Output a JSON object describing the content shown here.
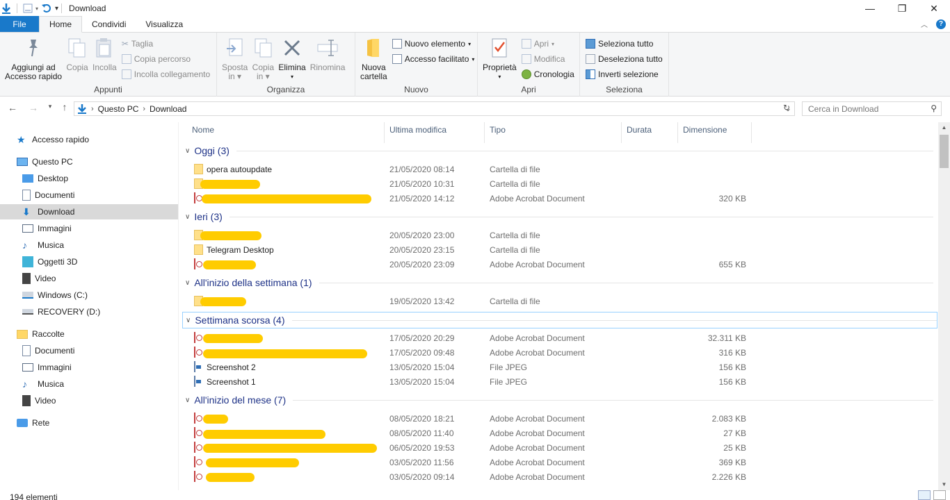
{
  "window": {
    "title": "Download"
  },
  "tabs": {
    "file": "File",
    "home": "Home",
    "share": "Condividi",
    "view": "Visualizza"
  },
  "ribbon": {
    "clipboard": {
      "label": "Appunti",
      "pin_line1": "Aggiungi ad",
      "pin_line2": "Accesso rapido",
      "copy": "Copia",
      "paste": "Incolla",
      "cut": "Taglia",
      "copy_path": "Copia percorso",
      "paste_shortcut": "Incolla collegamento"
    },
    "organize": {
      "label": "Organizza",
      "move_line1": "Sposta",
      "move_line2": "in",
      "copyto_line1": "Copia",
      "copyto_line2": "in",
      "delete": "Elimina",
      "rename": "Rinomina"
    },
    "new": {
      "label": "Nuovo",
      "newfolder_line1": "Nuova",
      "newfolder_line2": "cartella",
      "new_item": "Nuovo elemento",
      "easy_access": "Accesso facilitato"
    },
    "open": {
      "label": "Apri",
      "properties": "Proprietà",
      "open": "Apri",
      "edit": "Modifica",
      "history": "Cronologia"
    },
    "select": {
      "label": "Seleziona",
      "select_all": "Seleziona tutto",
      "select_none": "Deseleziona tutto",
      "invert": "Inverti selezione"
    }
  },
  "address": {
    "crumbs": [
      "Questo PC",
      "Download"
    ],
    "search_placeholder": "Cerca in Download"
  },
  "nav": {
    "quick_access": "Accesso rapido",
    "this_pc": "Questo PC",
    "desktop": "Desktop",
    "documents": "Documenti",
    "downloads": "Download",
    "pictures": "Immagini",
    "music": "Musica",
    "objects3d": "Oggetti 3D",
    "videos": "Video",
    "drive_c": "Windows (C:)",
    "drive_d": "RECOVERY (D:)",
    "libraries": "Raccolte",
    "lib_documents": "Documenti",
    "lib_pictures": "Immagini",
    "lib_music": "Musica",
    "lib_videos": "Video",
    "network": "Rete"
  },
  "columns": {
    "name": "Nome",
    "modified": "Ultima modifica",
    "type": "Tipo",
    "duration": "Durata",
    "size": "Dimensione"
  },
  "groups": [
    {
      "title": "Oggi (3)",
      "rows": [
        {
          "name": "opera autoupdate",
          "date": "21/05/2020 08:14",
          "type": "Cartella di file",
          "size": "",
          "icon": "folder-icon"
        },
        {
          "name": "",
          "date": "21/05/2020 10:31",
          "type": "Cartella di file",
          "size": "",
          "icon": "folder-icon"
        },
        {
          "name": "",
          "date": "21/05/2020 14:12",
          "type": "Adobe Acrobat Document",
          "size": "320 KB",
          "icon": "pdf-icon"
        }
      ]
    },
    {
      "title": "Ieri (3)",
      "rows": [
        {
          "name": "",
          "date": "20/05/2020 23:00",
          "type": "Cartella di file",
          "size": "",
          "icon": "folder-icon"
        },
        {
          "name": "Telegram Desktop",
          "date": "20/05/2020 23:15",
          "type": "Cartella di file",
          "size": "",
          "icon": "folder-icon"
        },
        {
          "name": "",
          "date": "20/05/2020 23:09",
          "type": "Adobe Acrobat Document",
          "size": "655 KB",
          "icon": "pdf-icon"
        }
      ]
    },
    {
      "title": "All'inizio della settimana (1)",
      "rows": [
        {
          "name": "",
          "date": "19/05/2020 13:42",
          "type": "Cartella di file",
          "size": "",
          "icon": "folder-icon"
        }
      ]
    },
    {
      "title": "Settimana scorsa (4)",
      "rows": [
        {
          "name": "",
          "date": "17/05/2020 20:29",
          "type": "Adobe Acrobat Document",
          "size": "32.311 KB",
          "icon": "pdf-icon"
        },
        {
          "name": "",
          "date": "17/05/2020 09:48",
          "type": "Adobe Acrobat Document",
          "size": "316 KB",
          "icon": "pdf-icon"
        },
        {
          "name": "Screenshot 2",
          "date": "13/05/2020 15:04",
          "type": "File JPEG",
          "size": "156 KB",
          "icon": "jpeg-icon"
        },
        {
          "name": "Screenshot 1",
          "date": "13/05/2020 15:04",
          "type": "File JPEG",
          "size": "156 KB",
          "icon": "jpeg-icon"
        }
      ]
    },
    {
      "title": "All'inizio del mese (7)",
      "rows": [
        {
          "name": "",
          "date": "08/05/2020 18:21",
          "type": "Adobe Acrobat Document",
          "size": "2.083 KB",
          "icon": "pdf-icon"
        },
        {
          "name": "",
          "date": "08/05/2020 11:40",
          "type": "Adobe Acrobat Document",
          "size": "27 KB",
          "icon": "pdf-icon"
        },
        {
          "name": "",
          "date": "06/05/2020 19:53",
          "type": "Adobe Acrobat Document",
          "size": "25 KB",
          "icon": "pdf-icon"
        },
        {
          "name": "",
          "date": "03/05/2020 11:56",
          "type": "Adobe Acrobat Document",
          "size": "369 KB",
          "icon": "pdf-icon"
        },
        {
          "name": "",
          "date": "03/05/2020 09:14",
          "type": "Adobe Acrobat Document",
          "size": "2.226 KB",
          "icon": "pdf-icon"
        }
      ]
    }
  ],
  "status": {
    "count": "194 elementi"
  }
}
